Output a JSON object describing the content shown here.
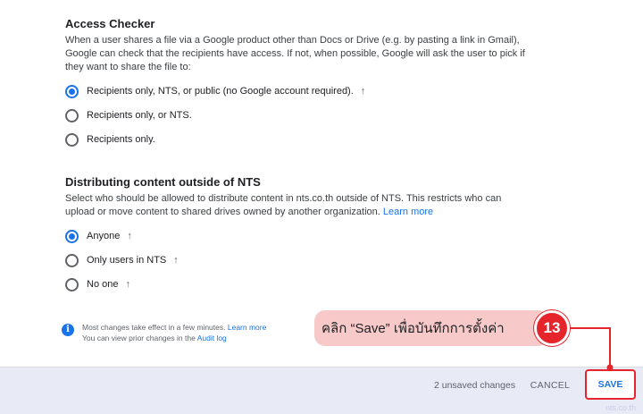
{
  "access_checker": {
    "title": "Access Checker",
    "desc_line1": "When a user shares a file via a Google product other than Docs or Drive (e.g. by pasting a link in Gmail),",
    "desc_line2": "Google can check that the recipients have access. If not, when possible, Google will ask the user to pick if",
    "desc_line3": "they want to share the file to:",
    "options": [
      {
        "label": "Recipients only, NTS, or public (no Google account required).",
        "checked": true,
        "arrow": "↑"
      },
      {
        "label": "Recipients only, or NTS.",
        "checked": false
      },
      {
        "label": "Recipients only.",
        "checked": false
      }
    ]
  },
  "distributing": {
    "title": "Distributing content outside of NTS",
    "desc_line1": "Select who should be allowed to distribute content in nts.co.th outside of NTS. This restricts who can",
    "desc_line2": "upload or move content to shared drives owned by another organization.",
    "learn_more": "Learn more",
    "options": [
      {
        "label": "Anyone",
        "checked": true,
        "arrow": "↑"
      },
      {
        "label": "Only users in NTS",
        "checked": false,
        "arrow": "↑"
      },
      {
        "label": "No one",
        "checked": false,
        "arrow": "↑"
      }
    ]
  },
  "info": {
    "icon": "i",
    "line1": "Most changes take effect in a few minutes.",
    "learn_more": "Learn more",
    "line2": "You can view prior changes in the",
    "audit_log": "Audit log"
  },
  "footer": {
    "unsaved": "2 unsaved changes",
    "cancel": "CANCEL",
    "save": "SAVE",
    "watermark": "nts.co.th"
  },
  "callout": {
    "text": "คลิก “Save” เพื่อบันทึกการตั้งค่า",
    "step": "13",
    "color": "#e5242b",
    "bg": "#f8c9c9"
  },
  "colors": {
    "accent": "#1a73e8",
    "footer_bg": "#e8eaf6"
  }
}
